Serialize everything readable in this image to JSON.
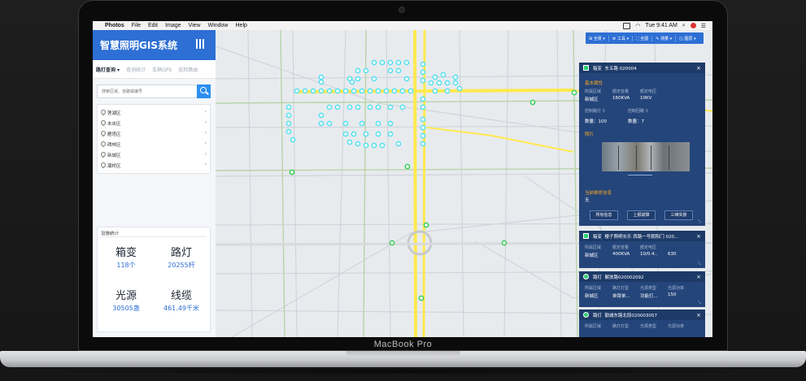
{
  "device": {
    "label": "MacBook Pro"
  },
  "menubar": {
    "apple": "",
    "app": "Photos",
    "items": [
      "File",
      "Edit",
      "Image",
      "View",
      "Window",
      "Help"
    ],
    "clock": "Tue 9:41 AM"
  },
  "sidebar": {
    "title": "智慧照明GIS系统",
    "tabs": [
      "路灯查询",
      "查询统计",
      "车辆GPS",
      "巡检路由"
    ],
    "search_placeholder": "搜索区域、道路或编号",
    "districts": [
      "莲湖区",
      "未央区",
      "雁塔区",
      "碑林区",
      "新城区",
      "灞桥区"
    ],
    "stats_title": "设施统计",
    "stats": [
      {
        "name": "箱变",
        "value": "118个"
      },
      {
        "name": "路灯",
        "value": "20255杆"
      },
      {
        "name": "光源",
        "value": "30505盏"
      },
      {
        "name": "线缆",
        "value": "461.49千米"
      }
    ]
  },
  "toolbar": {
    "items": [
      "全景",
      "工具",
      "全图",
      "测量",
      "图层"
    ]
  },
  "cards": [
    {
      "type": "箱变",
      "name": "东五路 020004",
      "section_basic": "基本属性",
      "headers": [
        "所属区域",
        "额定容量",
        "额定电压"
      ],
      "values": [
        "新城区",
        "160KVA",
        "10KV"
      ],
      "ctrl_labels": [
        "控制路灯",
        "控制回路"
      ],
      "ctrl_values": [
        "数量：100",
        "数量：7"
      ],
      "section_photo": "照片",
      "section_repair": "当前维修信息",
      "repair_value": "无",
      "buttons": [
        "所有信息",
        "上报故障",
        "三维实景"
      ]
    },
    {
      "type": "箱变",
      "name": "樱子照明长乐 西路一号朝阳门 020...",
      "headers": [
        "所属区域",
        "额定容量",
        "额定电压"
      ],
      "values": [
        "新城区",
        "400KVA",
        "10/0.4..",
        "630"
      ]
    },
    {
      "type": "路灯",
      "name": "解放路020002092",
      "headers": [
        "所属区域",
        "路灯灯型",
        "光源类型",
        "光源功率"
      ],
      "values": [
        "新城区",
        "单臂单...",
        "功能灯...",
        "150"
      ]
    },
    {
      "type": "路灯",
      "name": "勤城东路北段020003057",
      "headers": [
        "所属区域",
        "路灯灯型",
        "光源类型",
        "光源功率"
      ]
    }
  ],
  "colors": {
    "brand": "#2d6fd4",
    "card": "#24457a",
    "accent": "#f5a623",
    "marker": "#5ce0f0",
    "road_major": "#ffe94f"
  }
}
